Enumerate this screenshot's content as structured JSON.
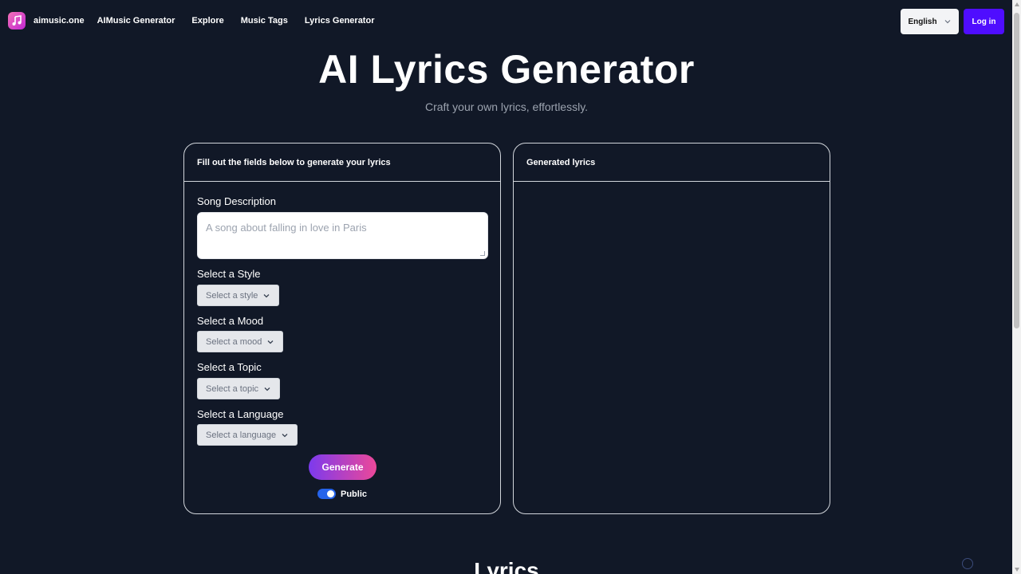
{
  "nav": {
    "brand": "aimusic.one",
    "links": [
      "AIMusic Generator",
      "Explore",
      "Music Tags",
      "Lyrics Generator"
    ],
    "language": "English",
    "login": "Log in"
  },
  "hero": {
    "title": "AI Lyrics Generator",
    "subtitle": "Craft your own lyrics, effortlessly."
  },
  "form": {
    "header": "Fill out the fields below to generate your lyrics",
    "description_label": "Song Description",
    "description_placeholder": "A song about falling in love in Paris",
    "style_label": "Select a Style",
    "style_placeholder": "Select a style",
    "mood_label": "Select a Mood",
    "mood_placeholder": "Select a mood",
    "topic_label": "Select a Topic",
    "topic_placeholder": "Select a topic",
    "language_label": "Select a Language",
    "language_placeholder": "Select a language",
    "generate": "Generate",
    "public_label": "Public",
    "public_enabled": true
  },
  "output": {
    "header": "Generated lyrics"
  },
  "section": {
    "lyrics_heading": "Lyrics"
  },
  "colors": {
    "background": "#111827",
    "accent": "#4f0dff",
    "gradient_start": "#7c3aed",
    "gradient_end": "#ec4899",
    "toggle": "#2563eb"
  }
}
